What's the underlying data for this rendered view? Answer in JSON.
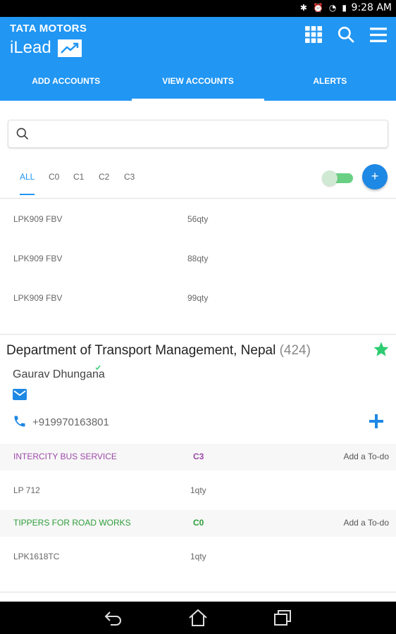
{
  "status_bar": {
    "time": "9:28 AM"
  },
  "brand": {
    "company": "TATA MOTORS",
    "app": "iLead"
  },
  "header_icons": [
    "grid-icon",
    "search-icon",
    "menu-icon"
  ],
  "tabs": [
    {
      "label": "ADD ACCOUNTS",
      "active": false
    },
    {
      "label": "VIEW ACCOUNTS",
      "active": true
    },
    {
      "label": "ALERTS",
      "active": false
    }
  ],
  "search": {
    "placeholder": ""
  },
  "filters": {
    "items": [
      "ALL",
      "C0",
      "C1",
      "C2",
      "C3"
    ],
    "selected": "ALL",
    "fab_label": "+"
  },
  "top_items": [
    {
      "model": "LPK909 FBV",
      "qty": "56qty"
    },
    {
      "model": "LPK909 FBV",
      "qty": "88qty"
    },
    {
      "model": "LPK909 FBV",
      "qty": "99qty"
    }
  ],
  "account": {
    "name": "Department of Transport Management, Nepal",
    "count": "(424)",
    "contact": "Gaurav Dhungana",
    "phone": "+919970163801",
    "groups": [
      {
        "label": "INTERCITY BUS SERVICE",
        "code": "C3",
        "todo": "Add a To-do",
        "color": "#9c4aa8",
        "items": [
          {
            "model": "LP 712",
            "qty": "1qty"
          }
        ]
      },
      {
        "label": "TIPPERS FOR ROAD WORKS",
        "code": "C0",
        "todo": "Add a To-do",
        "color": "#2e9d3a",
        "items": [
          {
            "model": "LPK1618TC",
            "qty": "1qty"
          }
        ]
      }
    ]
  },
  "colors": {
    "primary": "#2196f3",
    "star": "#2ecc71",
    "toggle": "#69d083"
  }
}
